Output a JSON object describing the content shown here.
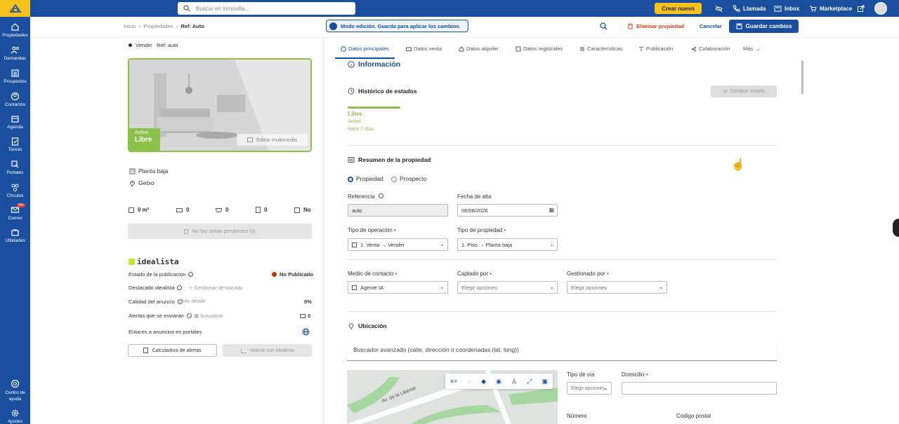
{
  "sidebar": {
    "items": [
      {
        "label": "Propiedades",
        "icon": "home-icon"
      },
      {
        "label": "Demandas",
        "icon": "users-icon"
      },
      {
        "label": "Prospectos",
        "icon": "list-icon"
      },
      {
        "label": "Contactos",
        "icon": "contact-icon"
      },
      {
        "label": "Agenda",
        "icon": "calendar-icon"
      },
      {
        "label": "Tareas",
        "icon": "clipboard-icon"
      },
      {
        "label": "Portales",
        "icon": "portal-icon"
      },
      {
        "label": "Círculos",
        "icon": "circles-icon"
      },
      {
        "label": "Correo",
        "icon": "mail-icon",
        "badge": "99+"
      },
      {
        "label": "Utilidades",
        "icon": "tools-icon"
      },
      {
        "label": "Centro de ayuda",
        "icon": "help-icon"
      },
      {
        "label": "Ajustes",
        "icon": "gear-icon"
      }
    ]
  },
  "topbar": {
    "search_placeholder": "Buscar en inmovilla...",
    "create": "Crear nuevo",
    "llamada": "Llamada",
    "inbox": "Inbox",
    "marketplace": "Marketplace"
  },
  "subbar": {
    "crumb_1": "Inicio",
    "crumb_2": "Propiedades",
    "crumb_3": "Ref: Auto",
    "modo": "Modo edición. Guarda para aplicar los cambios.",
    "eliminar": "Eliminar propiedad",
    "cancelar": "Cancelar",
    "guardar": "Guardar cambios"
  },
  "left": {
    "op": "Vender",
    "ref": "Ref: auto",
    "status_small": "Activo",
    "status_big": "Libre",
    "editar": "Editar multimedia",
    "planta": "Planta baja",
    "city": "Getxo",
    "stats": [
      "0 m²",
      "0",
      "0",
      "0",
      "No"
    ],
    "tareas": "No hay tareas pendientes (0)",
    "idealista_brand": "idealista",
    "rows": [
      {
        "label": "Estado de la publicación",
        "value": "No Publicado"
      },
      {
        "label": "Destacado idealista",
        "value": "Gestionar destacado"
      },
      {
        "label": "Calidad del anuncio",
        "value": "Ver detalle",
        "right": "0%"
      },
      {
        "label": "Alertas que se enviarán",
        "value": "Actualizar",
        "right": "0"
      },
      {
        "label": "Enlaces a anuncios en portales"
      }
    ],
    "calc": "Calculadora de alertas",
    "valorar": "Valorar con idealista"
  },
  "tabs": [
    "Datos principales",
    "Datos venta",
    "Datos alquiler",
    "Datos registrales",
    "Características",
    "Publicación",
    "Colaboración",
    "Más"
  ],
  "main": {
    "info": "Información",
    "historico": "Histórico de estados",
    "cambiar": "Cambiar estado",
    "estado": "Libre",
    "estado_sub": "Activo",
    "estado_time": "Hace 7 días",
    "resumen": "Resumen de la propiedad",
    "radio_1": "Propiedad",
    "radio_2": "Prospecto",
    "referencia": "Referencia",
    "referencia_val": "auto",
    "fecha": "Fecha de alta",
    "fecha_val": "06/08/2026",
    "tipo_op": "Tipo de operación",
    "tipo_op_val": "1. Venta → Vender",
    "tipo_prop": "Tipo de propiedad",
    "tipo_prop_val": "1. Piso → Planta baja",
    "medio": "Medio de contacto",
    "medio_val": "Agente IA",
    "captado": "Captado por",
    "captado_val": "Elegir opciones",
    "gestionado": "Gestionado por",
    "gestionado_val": "Elegir opciones",
    "ubicacion": "Ubicación",
    "buscador": "Buscador avanzado (calle, dirección o coordenadas (lat, long))",
    "tipo_via": "Tipo de vía",
    "tipo_via_val": "Elegir opciones",
    "domicilio": "Domicilio",
    "numero": "Número",
    "cp": "Código postal",
    "street": "Av. de la Libertat"
  }
}
